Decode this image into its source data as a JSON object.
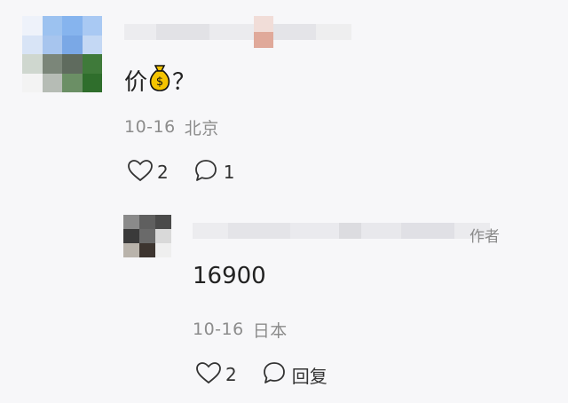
{
  "comment": {
    "text": "价",
    "text_suffix": "？",
    "emoji": "money-bag",
    "date": "10-16",
    "location": "北京",
    "likes": "2",
    "replies": "1"
  },
  "reply": {
    "author_tag": "作者",
    "text": "16900",
    "date": "10-16",
    "location": "日本",
    "likes": "2",
    "reply_label": "回复"
  },
  "colors": {
    "background": "#f7f7f9",
    "meta_text": "#8c8c8c",
    "icon_stroke": "#333333",
    "emoji_gold": "#e9b300"
  }
}
